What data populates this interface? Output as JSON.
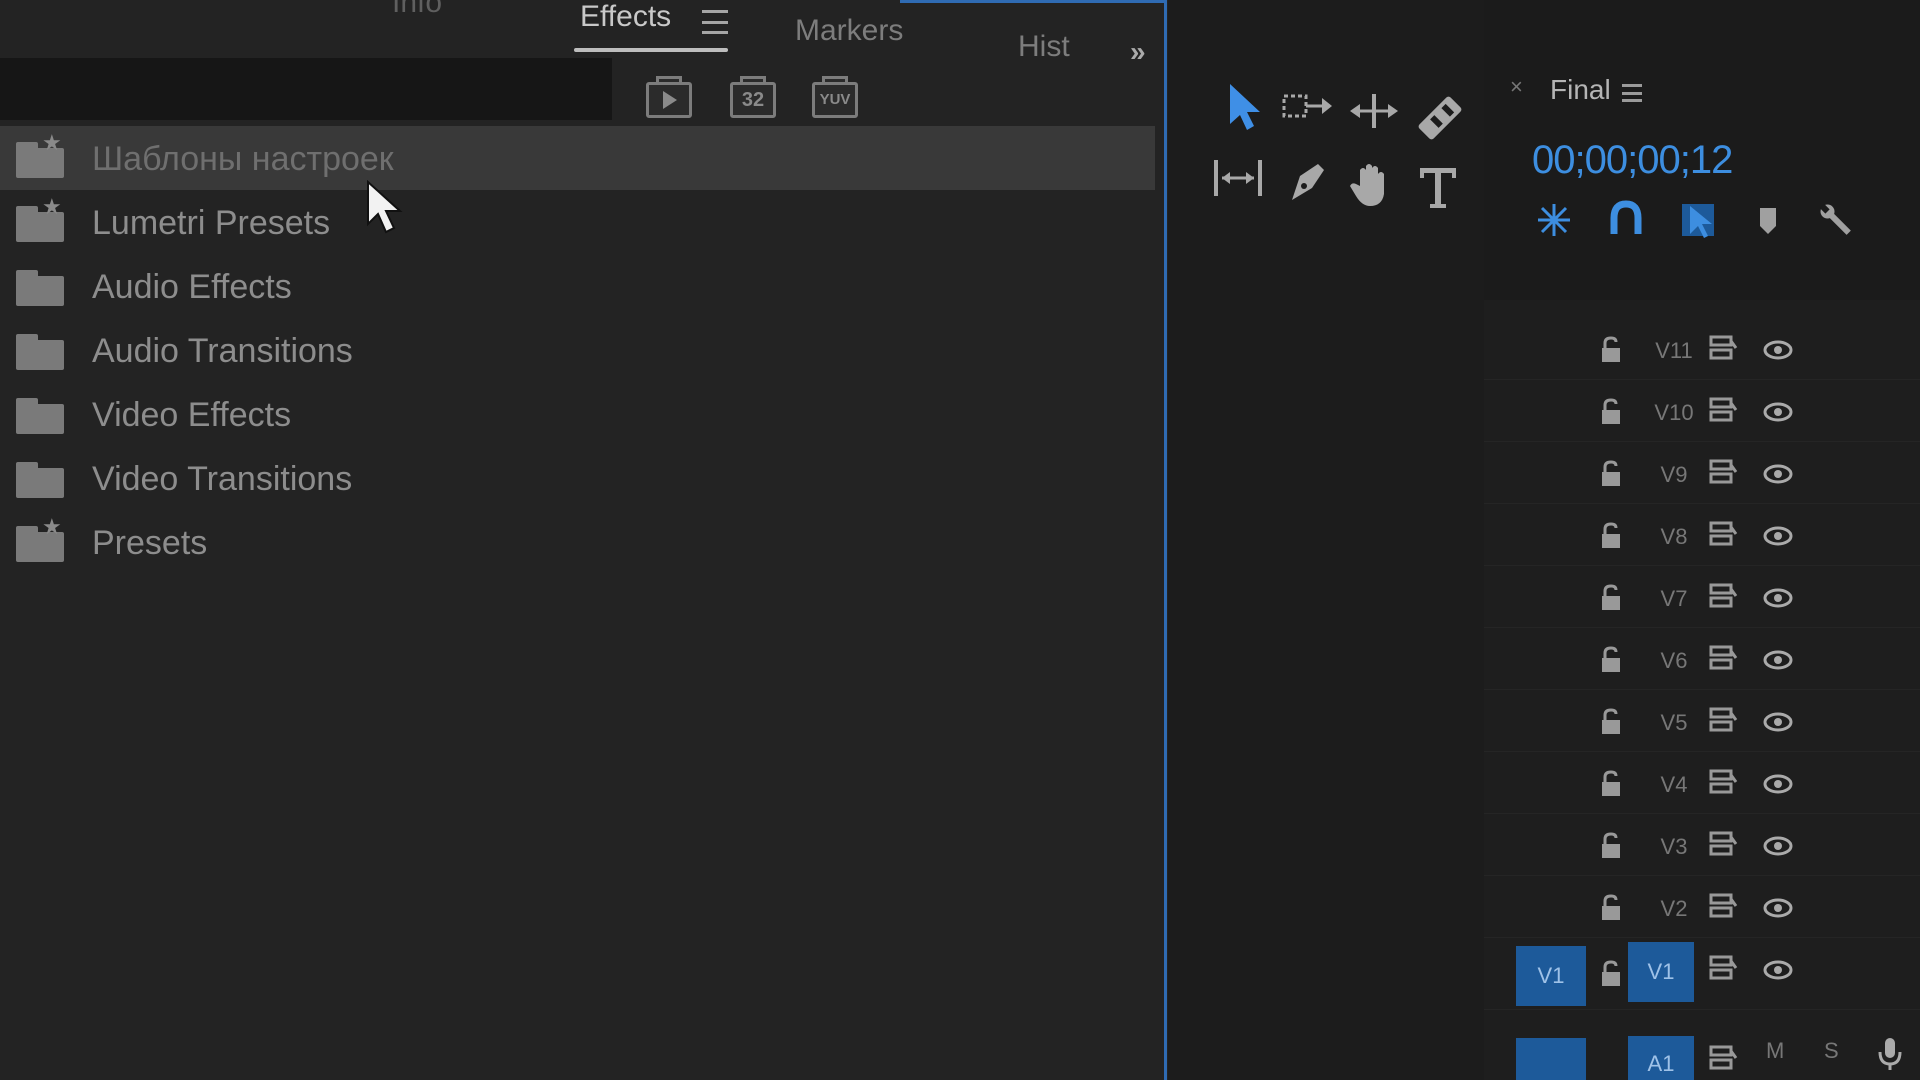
{
  "effects_panel": {
    "tabs": {
      "info": "Info",
      "effects": "Effects",
      "markers": "Markers",
      "history": "Hist",
      "overflow": "»"
    },
    "toolbar_buttons": [
      "new-bin",
      "32",
      "YUV"
    ],
    "tree": [
      {
        "label": "Шаблоны настроек",
        "icon": "preset-folder-icon",
        "selected": true
      },
      {
        "label": "Lumetri Presets",
        "icon": "preset-folder-icon",
        "selected": false
      },
      {
        "label": "Audio Effects",
        "icon": "folder-icon",
        "selected": false
      },
      {
        "label": "Audio Transitions",
        "icon": "folder-icon",
        "selected": false
      },
      {
        "label": "Video Effects",
        "icon": "folder-icon",
        "selected": false
      },
      {
        "label": "Video Transitions",
        "icon": "folder-icon",
        "selected": false
      },
      {
        "label": "Presets",
        "icon": "preset-folder-icon",
        "selected": false
      }
    ],
    "button_labels": {
      "accelerated": "",
      "bit32": "32",
      "yuv": "YUV"
    }
  },
  "tools": [
    "selection-tool-icon",
    "track-select-tool-icon",
    "ripple-edit-tool-icon",
    "razor-tool-icon",
    "slip-tool-icon",
    "pen-tool-icon",
    "hand-tool-icon",
    "type-tool-icon"
  ],
  "timeline": {
    "close": "×",
    "title": "Final",
    "timecode": "00;00;00;12",
    "tracks": [
      {
        "name": "V11"
      },
      {
        "name": "V10"
      },
      {
        "name": "V9"
      },
      {
        "name": "V8"
      },
      {
        "name": "V7"
      },
      {
        "name": "V6"
      },
      {
        "name": "V5"
      },
      {
        "name": "V4"
      },
      {
        "name": "V3"
      },
      {
        "name": "V2"
      },
      {
        "name": "V1",
        "source": "V1"
      }
    ],
    "audio_track": {
      "name": "A1",
      "mute": "M",
      "solo": "S"
    }
  },
  "colors": {
    "accent": "#2f6bb3",
    "timecode": "#3d8ee0",
    "patch": "#1d5a9a"
  }
}
